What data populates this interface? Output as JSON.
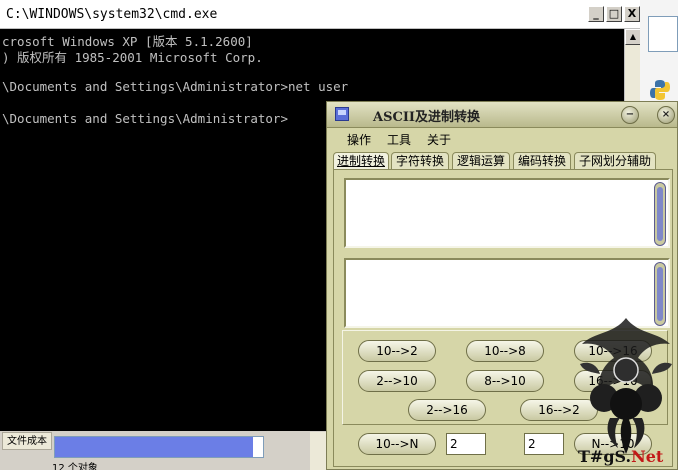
{
  "cmd": {
    "title": "C:\\WINDOWS\\system32\\cmd.exe",
    "lines": [
      "crosoft Windows XP [版本 5.1.2600]",
      ") 版权所有 1985-2001 Microsoft Corp.",
      "",
      "\\Documents and Settings\\Administrator>net user",
      "",
      "\\Documents and Settings\\Administrator>"
    ],
    "buttons": {
      "minimize": "_",
      "maximize": "□",
      "close": "X"
    }
  },
  "explorer": {
    "tab_label": "文件成本",
    "progress": 0.95,
    "status": "12 个对象"
  },
  "app": {
    "title": "ASCII及进制转换",
    "title_buttons": {
      "minimize": "−",
      "close": "×"
    },
    "menu": [
      "操作",
      "工具",
      "关于"
    ],
    "tabs": [
      "进制转换",
      "字符转换",
      "逻辑运算",
      "编码转换",
      "子网划分辅助"
    ],
    "active_tab": 0,
    "input_text": "",
    "output_text": "",
    "buttons": {
      "dec_to_bin": "10-->2",
      "dec_to_oct": "10-->8",
      "dec_to_hex": "10-->16",
      "bin_to_dec": "2-->10",
      "oct_to_dec": "8-->10",
      "hex_to_dec": "16-->10",
      "bin_to_hex": "2-->16",
      "hex_to_bin": "16-->2",
      "dec_to_n": "10-->N",
      "n_to_dec": "N-->10"
    },
    "n_value_a": "2",
    "n_value_b": "2"
  },
  "watermark": {
    "text_black": "T#gS.",
    "text_red": "Net"
  },
  "colors": {
    "app_bg": "#d6d6a8",
    "cmd_bg": "#000000",
    "cmd_fg": "#c0c0c0",
    "progress": "#6b7ee6"
  }
}
